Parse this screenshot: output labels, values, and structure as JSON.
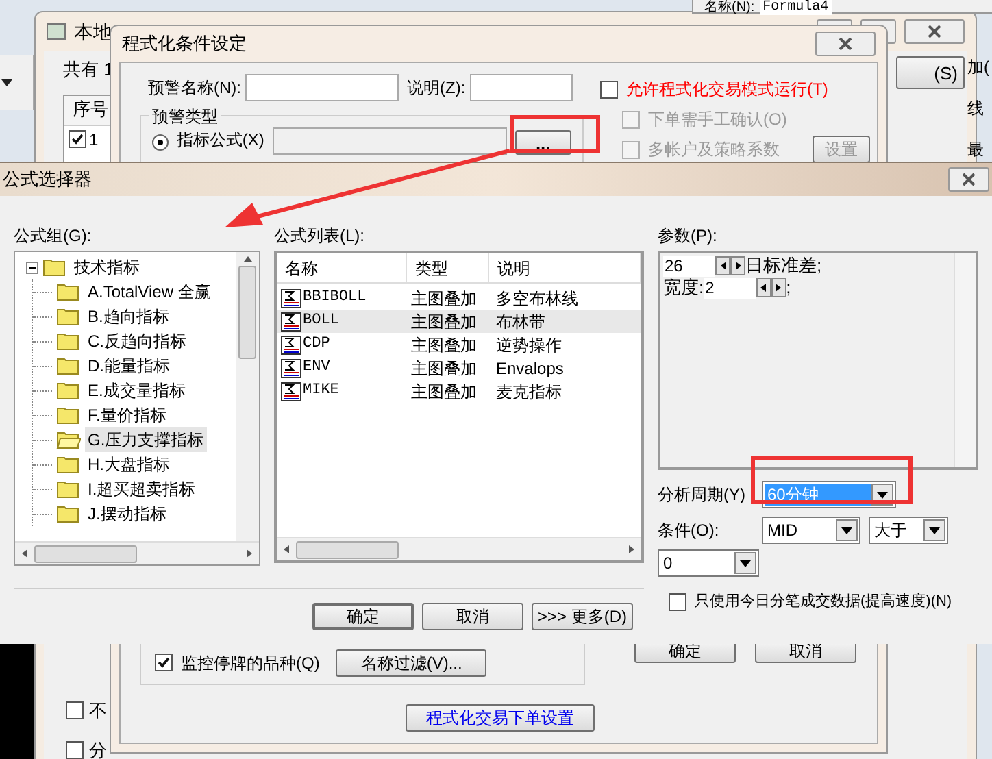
{
  "background_window": {
    "title": "本地",
    "count_label": "共有 1",
    "table": {
      "columns": [
        "序号"
      ],
      "rows": [
        {
          "checked": true,
          "cells": [
            "1"
          ]
        }
      ]
    },
    "side_button": "(S)",
    "edge_fragments": [
      "加(",
      "线",
      "最"
    ],
    "options": [
      {
        "label": "不",
        "checked": false
      },
      {
        "label": "分",
        "checked": false
      }
    ]
  },
  "formula_window": {
    "name_label": "名称(N):",
    "name_value": "Formula4"
  },
  "condition_dialog": {
    "title": "程式化条件设定",
    "name_label": "预警名称(N):",
    "desc_label": "说明(Z):",
    "allow_program": {
      "label": "允许程式化交易模式运行(T)",
      "checked": false
    },
    "sub_options": [
      {
        "label": "下单需手工确认(O)",
        "checked": false,
        "disabled": true
      },
      {
        "label": "多帐户及策略系数",
        "checked": false,
        "disabled": true
      }
    ],
    "settings_button": {
      "label": "设置",
      "disabled": true
    },
    "type_group": {
      "title": "预警类型",
      "radio": {
        "label": "指标公式(X)",
        "selected": true
      },
      "browse_button": "..."
    },
    "monitor_suspended": {
      "label": "监控停牌的品种(Q)",
      "checked": true
    },
    "filter_button": "名称过滤(V)...",
    "ok_button": "确定",
    "cancel_button": "取消",
    "order_settings_button": "程式化交易下单设置"
  },
  "formula_selector": {
    "title": "公式选择器",
    "group_label": "公式组(G):",
    "tree": [
      {
        "label": "技术指标",
        "expanded": true,
        "selected": false,
        "children": [
          {
            "label": "A.TotalView 全赢",
            "selected": false
          },
          {
            "label": "B.趋向指标",
            "selected": false
          },
          {
            "label": "C.反趋向指标",
            "selected": false
          },
          {
            "label": "D.能量指标",
            "selected": false
          },
          {
            "label": "E.成交量指标",
            "selected": false
          },
          {
            "label": "F.量价指标",
            "selected": false
          },
          {
            "label": "G.压力支撑指标",
            "selected": true
          },
          {
            "label": "H.大盘指标",
            "selected": false
          },
          {
            "label": "I.超买超卖指标",
            "selected": false
          },
          {
            "label": "J.摆动指标",
            "selected": false
          }
        ]
      }
    ],
    "list_label": "公式列表(L):",
    "list_columns": [
      "名称",
      "类型",
      "说明"
    ],
    "list_rows": [
      {
        "cells": [
          "BBIBOLL",
          "主图叠加",
          "多空布林线"
        ],
        "selected": false
      },
      {
        "cells": [
          "BOLL",
          "主图叠加",
          "布林带"
        ],
        "selected": true
      },
      {
        "cells": [
          "CDP",
          "主图叠加",
          "逆势操作"
        ],
        "selected": false
      },
      {
        "cells": [
          "ENV",
          "主图叠加",
          "Envalops"
        ],
        "selected": false
      },
      {
        "cells": [
          "MIKE",
          "主图叠加",
          "麦克指标"
        ],
        "selected": false
      }
    ],
    "params_label": "参数(P):",
    "params": [
      {
        "value": "26",
        "suffix": "日标准差;"
      },
      {
        "prefix": "宽度:",
        "value": "2",
        "suffix": ";"
      }
    ],
    "period_label": "分析周期(Y)",
    "period": "60分钟",
    "condition_label": "条件(O):",
    "condition_line": "MID",
    "condition_op": "大于",
    "condition_value": "0",
    "tick_data": {
      "label": "只使用今日分笔成交数据(提高速度)(N)",
      "checked": false
    },
    "ok_button": "确定",
    "cancel_button": "取消",
    "more_button": ">>> 更多(D)"
  }
}
